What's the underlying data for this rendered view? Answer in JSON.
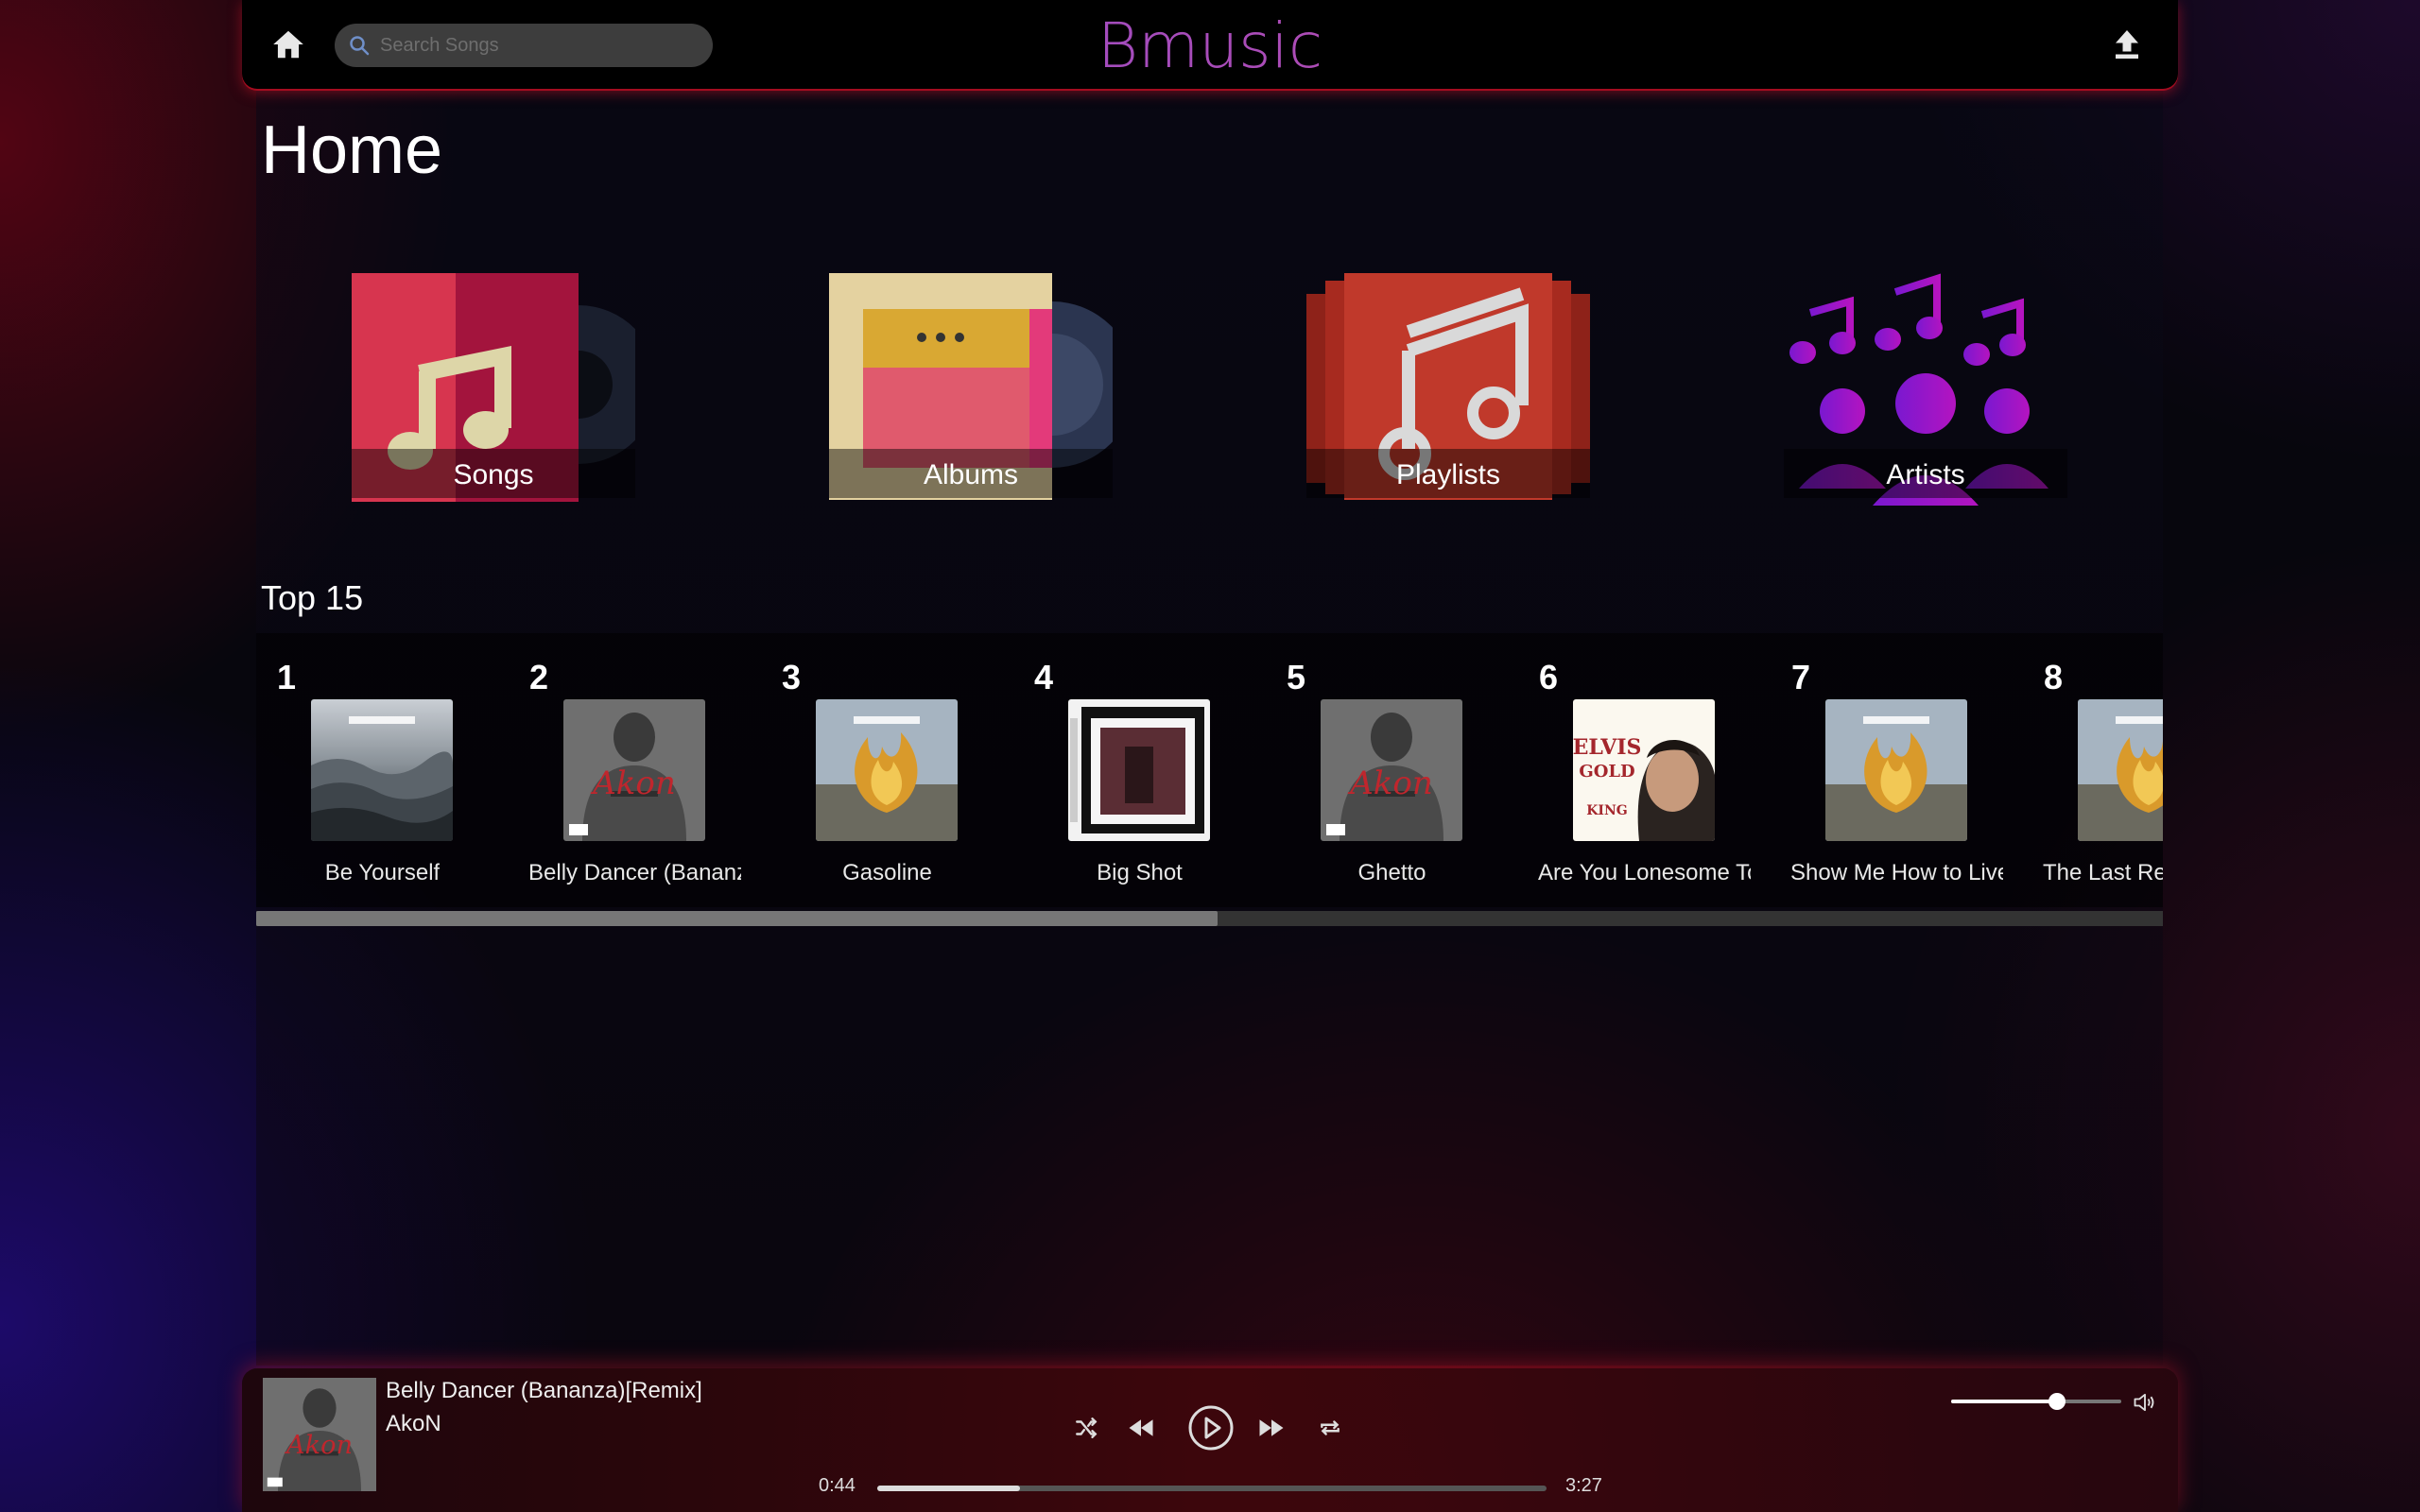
{
  "app": {
    "brand": "Bmusic"
  },
  "search": {
    "placeholder": "Search Songs"
  },
  "page": {
    "title": "Home"
  },
  "categories": [
    {
      "label": "Songs"
    },
    {
      "label": "Albums"
    },
    {
      "label": "Playlists"
    },
    {
      "label": "Artists"
    }
  ],
  "top": {
    "title": "Top 15",
    "items": [
      {
        "rank": "1",
        "song": "Be Yourself",
        "cover": "audioslave-ocean"
      },
      {
        "rank": "2",
        "song": "Belly Dancer (Bananza)[Remix]",
        "cover": "akon"
      },
      {
        "rank": "3",
        "song": "Gasoline",
        "cover": "audioslave-fire"
      },
      {
        "rank": "4",
        "song": "Big Shot",
        "cover": "big-shot"
      },
      {
        "rank": "5",
        "song": "Ghetto",
        "cover": "akon"
      },
      {
        "rank": "6",
        "song": "Are You Lonesome Tonight",
        "cover": "elvis"
      },
      {
        "rank": "7",
        "song": "Show Me How to Live",
        "cover": "audioslave-fire"
      },
      {
        "rank": "8",
        "song": "The Last Remaining Light",
        "cover": "audioslave-fire"
      }
    ],
    "scroll_fraction": 0.504
  },
  "player": {
    "title": "Belly Dancer (Bananza)[Remix]",
    "artist": "AkoN",
    "current_time": "0:44",
    "total_time": "3:27",
    "progress": 0.213,
    "volume": 0.62
  },
  "colors": {
    "brand_gradient_start": "#7e4cd8",
    "brand_gradient_end": "#d24c9b",
    "songs_tile": "#d7354f",
    "albums_tile": "#e4d2a0",
    "playlists_tile": "#c0392b",
    "artists_icon": "#8e14c8"
  }
}
